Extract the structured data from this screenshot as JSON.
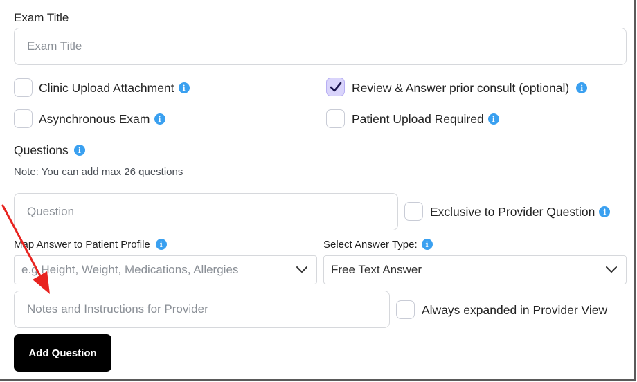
{
  "exam_title": {
    "label": "Exam Title",
    "placeholder": "Exam Title"
  },
  "options": {
    "clinic_upload": {
      "label": "Clinic Upload Attachment",
      "checked": false
    },
    "review_prior": {
      "label": "Review & Answer prior consult (optional)",
      "checked": true
    },
    "async_exam": {
      "label": "Asynchronous Exam",
      "checked": false
    },
    "patient_upload": {
      "label": "Patient Upload Required",
      "checked": false
    }
  },
  "questions": {
    "heading": "Questions",
    "note": "Note: You can add max 26 questions",
    "question_placeholder": "Question",
    "exclusive_label": "Exclusive to Provider Question",
    "map_label": "Map Answer to Patient Profile",
    "map_placeholder": "e.g Height, Weight, Medications, Allergies",
    "answer_type_label": "Select Answer Type:",
    "answer_type_value": "Free Text Answer",
    "notes_placeholder": "Notes and Instructions for Provider",
    "expanded_label": "Always expanded in Provider View",
    "add_button": "Add Question"
  },
  "colors": {
    "accent_check": "#d9d4fb",
    "info": "#3aa0f0",
    "annotation": "#e8231f"
  }
}
